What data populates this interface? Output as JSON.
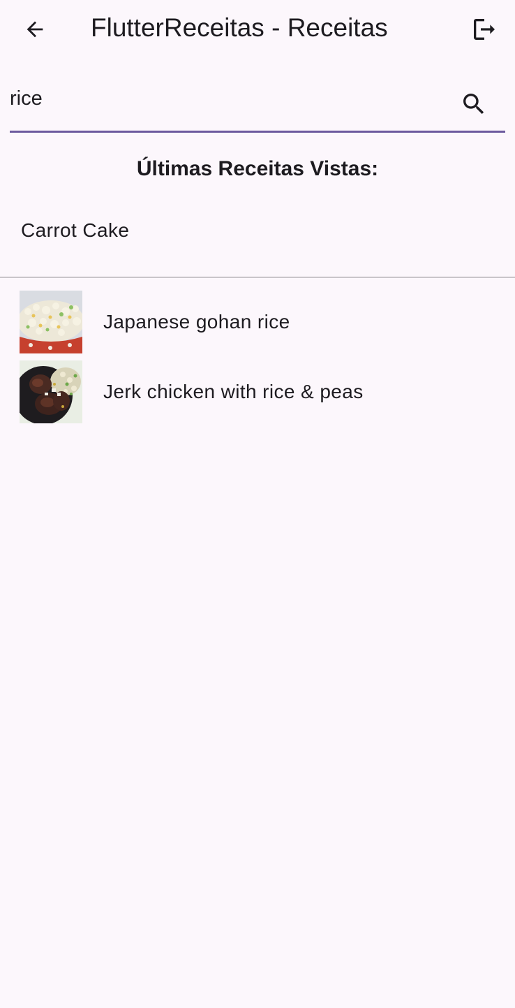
{
  "appbar": {
    "title": "FlutterReceitas - Receitas",
    "back_icon": "arrow-back-icon",
    "logout_icon": "logout-icon"
  },
  "search": {
    "value": "rice",
    "icon": "search-icon",
    "underline_color": "#6C5A9E"
  },
  "recent": {
    "heading": "Últimas Receitas Vistas:",
    "items": [
      {
        "label": "Carrot Cake"
      }
    ]
  },
  "results": [
    {
      "label": "Japanese gohan rice",
      "thumbnail": "rice-bowl-photo"
    },
    {
      "label": "Jerk chicken with rice & peas",
      "thumbnail": "jerk-chicken-photo"
    }
  ],
  "colors": {
    "background": "#FCF7FC",
    "text": "#1D1B20",
    "divider": "#C9C5CA"
  }
}
